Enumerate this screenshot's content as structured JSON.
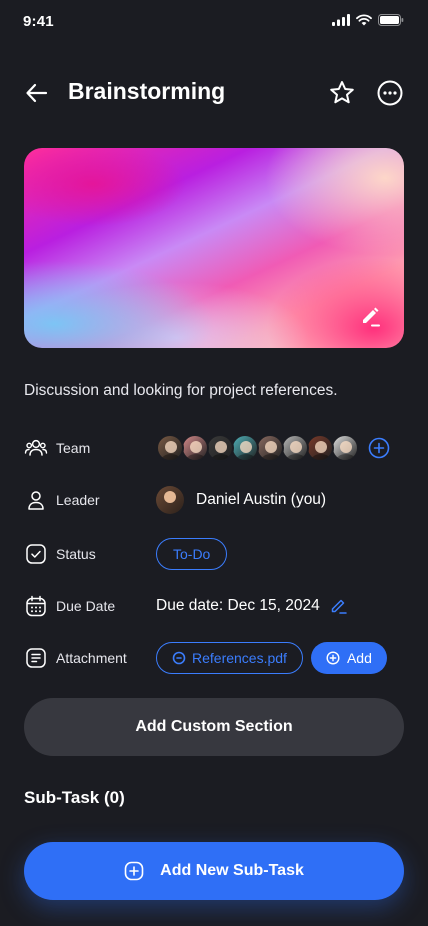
{
  "status_bar": {
    "time": "9:41"
  },
  "header": {
    "title": "Brainstorming"
  },
  "description": "Discussion and looking for project references.",
  "details": {
    "team_label": "Team",
    "team_members": [
      {
        "color": "#7a5a44"
      },
      {
        "color": "#d48a8a"
      },
      {
        "color": "#3a3a3a"
      },
      {
        "color": "#4fb0b8"
      },
      {
        "color": "#8a6a60"
      },
      {
        "color": "#b8b8b8"
      },
      {
        "color": "#7a3a2a"
      },
      {
        "color": "#e0e0e0"
      }
    ],
    "leader_label": "Leader",
    "leader_name": "Daniel Austin (you)",
    "status_label": "Status",
    "status_value": "To-Do",
    "due_label": "Due Date",
    "due_value": "Due date: Dec 15, 2024",
    "attachment_label": "Attachment",
    "attachment_file": "References.pdf",
    "attachment_add": "Add"
  },
  "buttons": {
    "custom_section": "Add Custom Section",
    "add_subtask": "Add New Sub-Task"
  },
  "subtask": {
    "title": "Sub-Task (0)"
  },
  "colors": {
    "accent": "#2f6ff6",
    "background": "#1b1c22",
    "surface": "#37383f"
  }
}
